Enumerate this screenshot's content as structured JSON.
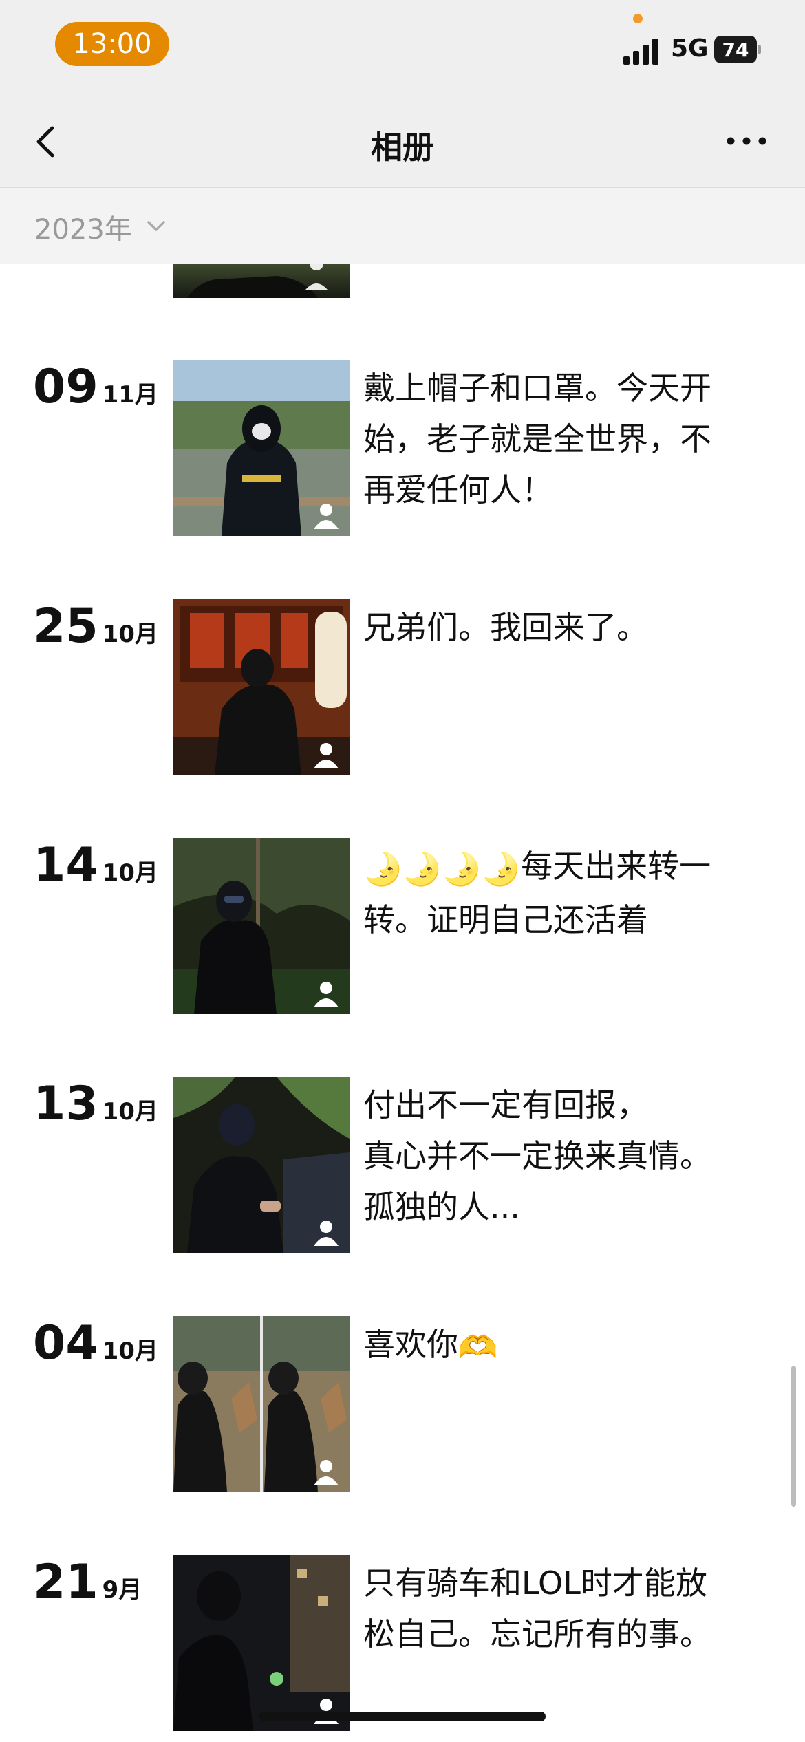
{
  "status_bar": {
    "time": "13:00",
    "network": "5G",
    "battery": "74"
  },
  "nav": {
    "title": "相册",
    "back_icon": "chevron-left-icon",
    "more_icon": "more-dots-icon"
  },
  "year_filter": {
    "label": "2023年",
    "icon": "chevron-down-icon"
  },
  "posts": [
    {
      "day": "09",
      "month": "11月",
      "lines": [
        "戴上帽子和口罩。今天开",
        "始，老子就是全世界，不",
        "再爱任何人！"
      ]
    },
    {
      "day": "25",
      "month": "10月",
      "lines": [
        "兄弟们。我回来了。"
      ]
    },
    {
      "day": "14",
      "month": "10月",
      "emoji_prefix": "🌛🌛🌛🌛",
      "lines": [
        "每天出来转一",
        "转。证明自己还活着"
      ]
    },
    {
      "day": "13",
      "month": "10月",
      "lines": [
        "付出不一定有回报，",
        "真心并不一定换来真情。",
        "孤独的人..."
      ]
    },
    {
      "day": "04",
      "month": "10月",
      "lines": [
        "喜欢你"
      ],
      "emoji_suffix": "🫶"
    },
    {
      "day": "21",
      "month": "9月",
      "lines": [
        "只有骑车和LOL时才能放",
        "松自己。忘记所有的事。"
      ]
    }
  ],
  "colors": {
    "accent": "#e58a00",
    "bar_bg": "#efefef",
    "muted": "#999999"
  }
}
